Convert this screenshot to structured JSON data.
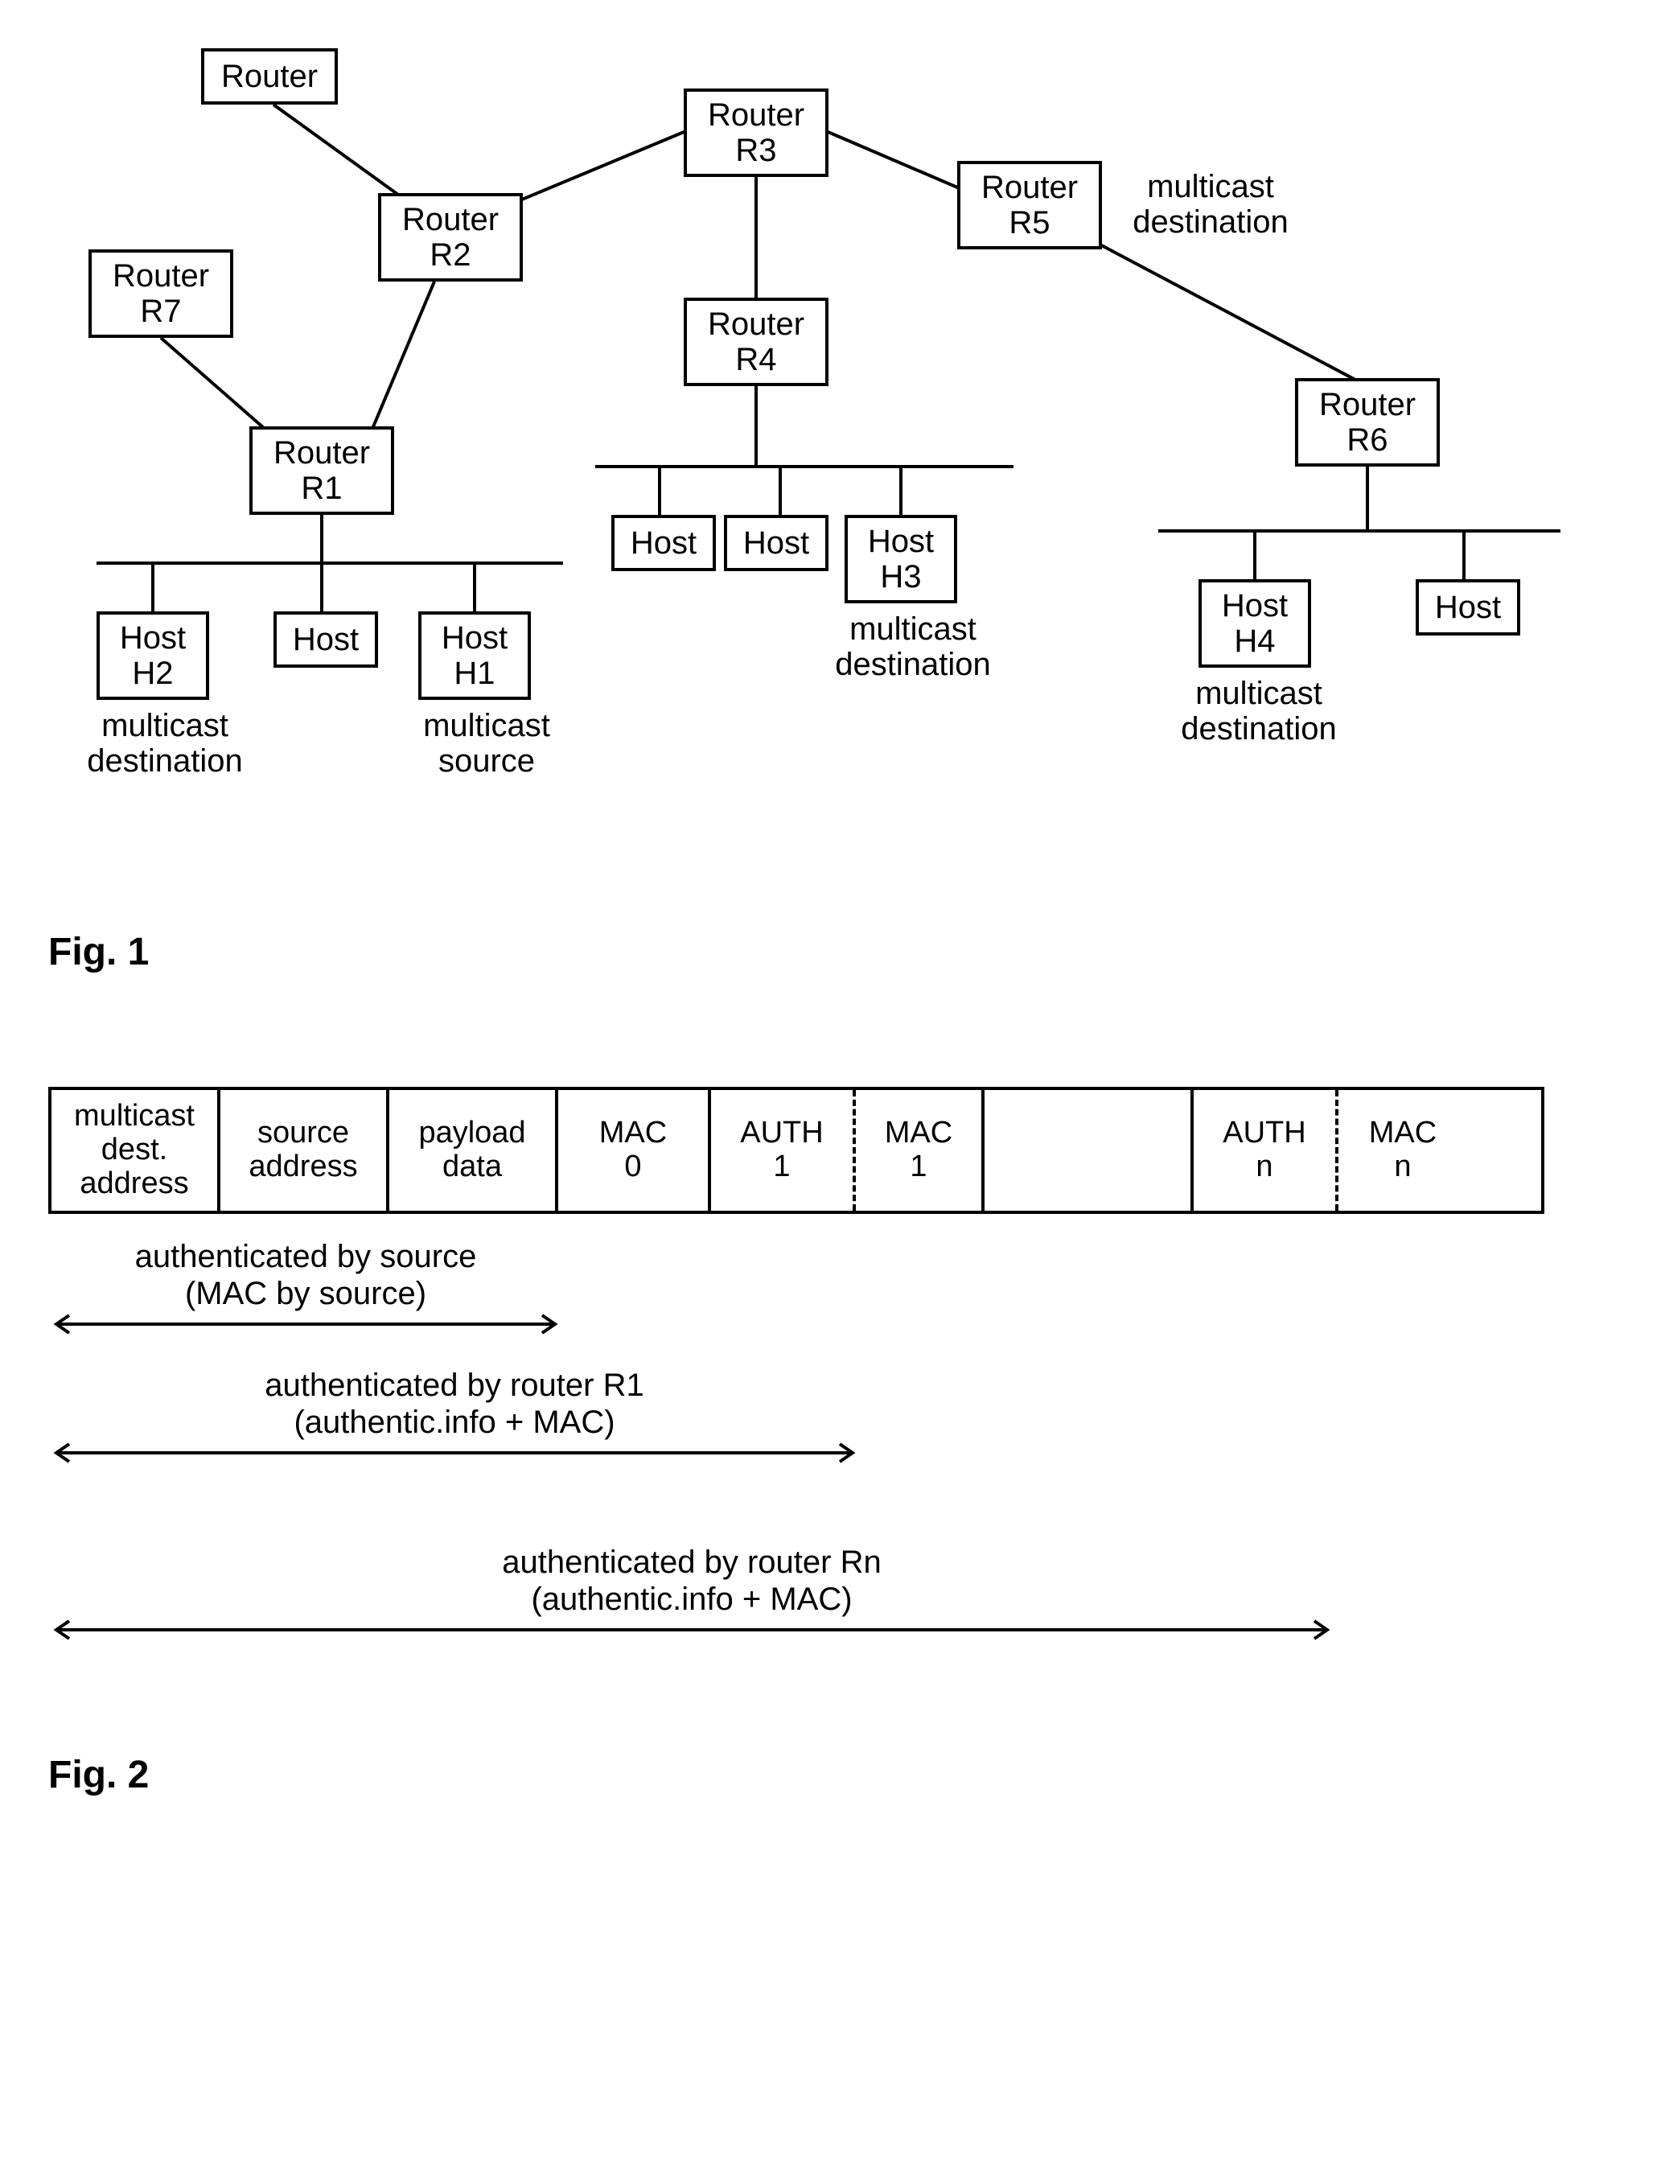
{
  "fig1": {
    "label": "Fig. 1",
    "nodes": {
      "routerTop": "Router",
      "r3_l1": "Router",
      "r3_l2": "R3",
      "r2_l1": "Router",
      "r2_l2": "R2",
      "r5_l1": "Router",
      "r5_l2": "R5",
      "r7_l1": "Router",
      "r7_l2": "R7",
      "r4_l1": "Router",
      "r4_l2": "R4",
      "r6_l1": "Router",
      "r6_l2": "R6",
      "r1_l1": "Router",
      "r1_l2": "R1",
      "host_a": "Host",
      "host_b": "Host",
      "h3_l1": "Host",
      "h3_l2": "H3",
      "h4_l1": "Host",
      "h4_l2": "H4",
      "host_c": "Host",
      "h2_l1": "Host",
      "h2_l2": "H2",
      "host_d": "Host",
      "h1_l1": "Host",
      "h1_l2": "H1"
    },
    "annotations": {
      "r5_annot_l1": "multicast",
      "r5_annot_l2": "destination",
      "h3_annot_l1": "multicast",
      "h3_annot_l2": "destination",
      "h4_annot_l1": "multicast",
      "h4_annot_l2": "destination",
      "h2_annot_l1": "multicast",
      "h2_annot_l2": "destination",
      "h1_annot_l1": "multicast",
      "h1_annot_l2": "source"
    }
  },
  "fig2": {
    "label": "Fig. 2",
    "cells": {
      "c0_l1": "multicast",
      "c0_l2": "dest.",
      "c0_l3": "address",
      "c1_l1": "source",
      "c1_l2": "address",
      "c2_l1": "payload",
      "c2_l2": "data",
      "c3_l1": "MAC",
      "c3_l2": "0",
      "c4_l1": "AUTH",
      "c4_l2": "1",
      "c5_l1": "MAC",
      "c5_l2": "1",
      "c6_l1": "",
      "c7_l1": "AUTH",
      "c7_l2": "n",
      "c8_l1": "MAC",
      "c8_l2": "n"
    },
    "arrows": {
      "a0_l1": "authenticated by source",
      "a0_l2": "(MAC by source)",
      "a1_l1": "authenticated by router R1",
      "a1_l2": "(authentic.info + MAC)",
      "a2_l1": "authenticated by router Rn",
      "a2_l2": "(authentic.info + MAC)"
    }
  },
  "chart_data": [
    {
      "type": "diagram",
      "title": "Fig. 1 — multicast network topology",
      "nodes": [
        {
          "id": "RouterTop",
          "label": "Router"
        },
        {
          "id": "R3",
          "label": "Router R3"
        },
        {
          "id": "R2",
          "label": "Router R2"
        },
        {
          "id": "R5",
          "label": "Router R5",
          "note": "multicast destination"
        },
        {
          "id": "R7",
          "label": "Router R7"
        },
        {
          "id": "R4",
          "label": "Router R4"
        },
        {
          "id": "R6",
          "label": "Router R6"
        },
        {
          "id": "R1",
          "label": "Router R1"
        },
        {
          "id": "HostA",
          "label": "Host"
        },
        {
          "id": "HostB",
          "label": "Host"
        },
        {
          "id": "H3",
          "label": "Host H3",
          "note": "multicast destination"
        },
        {
          "id": "H4",
          "label": "Host H4",
          "note": "multicast destination"
        },
        {
          "id": "HostC",
          "label": "Host"
        },
        {
          "id": "H2",
          "label": "Host H2",
          "note": "multicast destination"
        },
        {
          "id": "HostD",
          "label": "Host"
        },
        {
          "id": "H1",
          "label": "Host H1",
          "note": "multicast source"
        }
      ],
      "edges": [
        [
          "RouterTop",
          "R2"
        ],
        [
          "R2",
          "R3"
        ],
        [
          "R3",
          "R4"
        ],
        [
          "R3",
          "R5"
        ],
        [
          "R5",
          "R6"
        ],
        [
          "R2",
          "R1"
        ],
        [
          "R7",
          "R1"
        ],
        [
          "R1",
          "H2"
        ],
        [
          "R1",
          "HostD"
        ],
        [
          "R1",
          "H1"
        ],
        [
          "R4",
          "HostA"
        ],
        [
          "R4",
          "HostB"
        ],
        [
          "R4",
          "H3"
        ],
        [
          "R6",
          "H4"
        ],
        [
          "R6",
          "HostC"
        ]
      ]
    },
    {
      "type": "diagram",
      "title": "Fig. 2 — packet fields and authentication spans",
      "fields": [
        "multicast dest. address",
        "source address",
        "payload data",
        "MAC 0",
        "AUTH 1",
        "MAC 1",
        "(gap)",
        "AUTH n",
        "MAC n"
      ],
      "spans": [
        {
          "label": "authenticated by source (MAC by source)",
          "covers_fields": [
            0,
            1,
            2
          ]
        },
        {
          "label": "authenticated by router R1 (authentic.info + MAC)",
          "covers_fields": [
            0,
            1,
            2,
            3,
            4
          ]
        },
        {
          "label": "authenticated by router Rn (authentic.info + MAC)",
          "covers_fields": [
            0,
            1,
            2,
            3,
            4,
            5,
            6,
            7
          ]
        }
      ]
    }
  ]
}
